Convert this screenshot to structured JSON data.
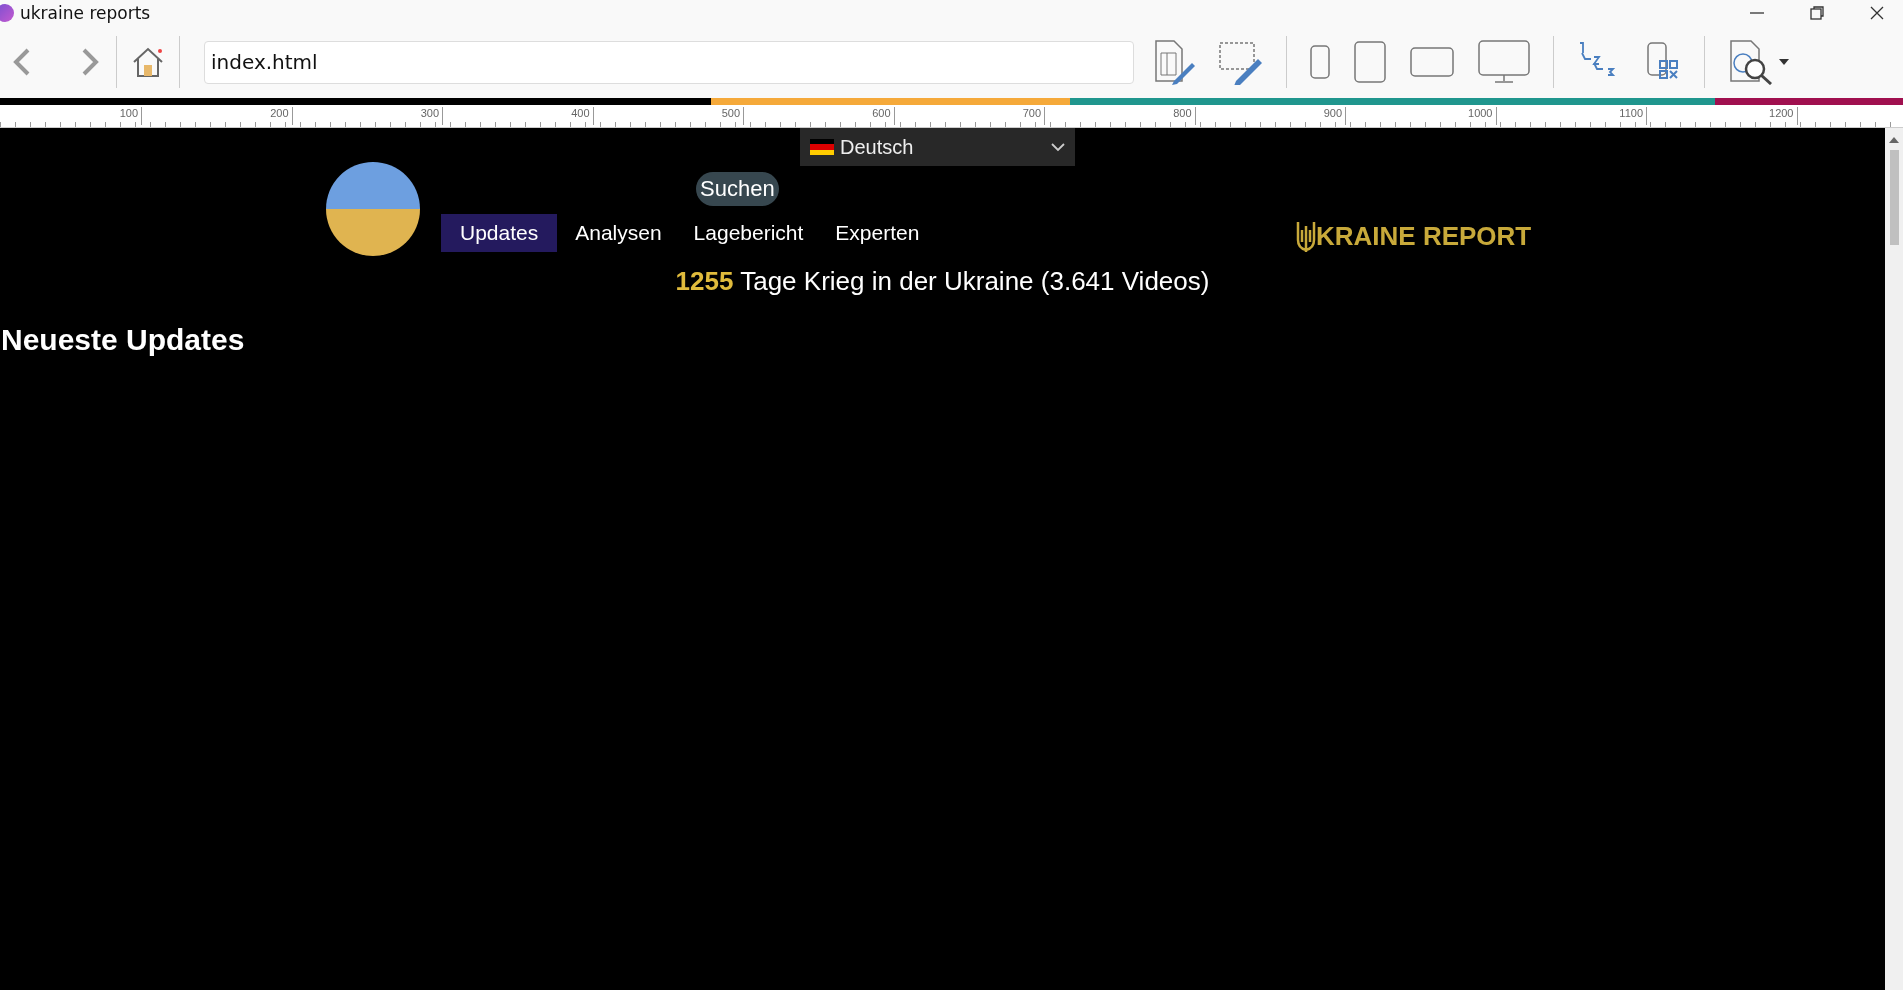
{
  "window": {
    "title": "ukraine reports"
  },
  "toolbar": {
    "address": "index.html"
  },
  "ruler": {
    "labels": [
      "100",
      "200",
      "300",
      "400",
      "500",
      "600",
      "700",
      "800",
      "900",
      "1000",
      "1100",
      "1200"
    ]
  },
  "page": {
    "language": {
      "value": "Deutsch"
    },
    "search_button": "Suchen",
    "nav": [
      {
        "label": "Updates",
        "selected": true
      },
      {
        "label": "Analysen",
        "selected": false
      },
      {
        "label": "Lagebericht",
        "selected": false
      },
      {
        "label": "Experten",
        "selected": false
      }
    ],
    "brand": "KRAINE REPORT",
    "headline": {
      "count": "1255",
      "text": "Tage Krieg in der Ukraine (3.641 Videos)"
    },
    "section_title": "Neueste Updates"
  }
}
